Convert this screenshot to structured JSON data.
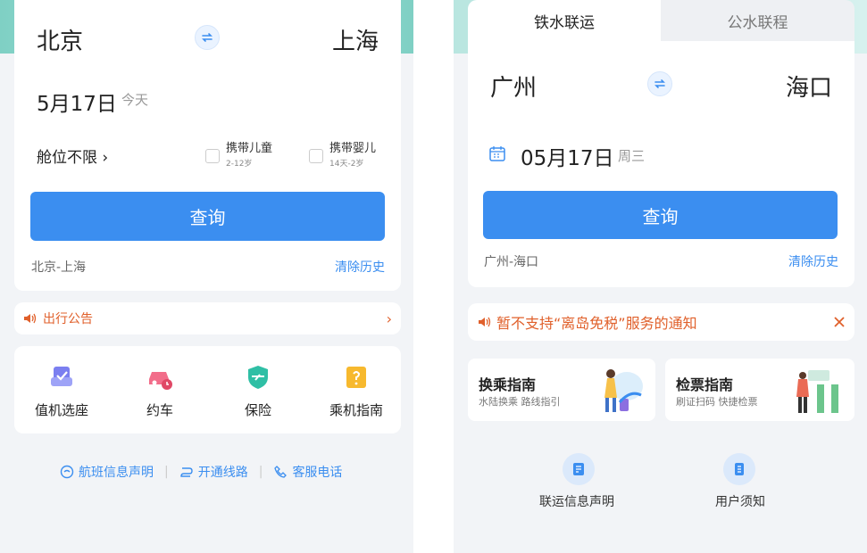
{
  "left": {
    "from_city": "北京",
    "to_city": "上海",
    "date": "5月17日",
    "date_tag": "今天",
    "cabin": "舱位不限 ›",
    "child": {
      "label": "携带儿童",
      "sub": "2-12岁"
    },
    "infant": {
      "label": "携带婴儿",
      "sub": "14天-2岁"
    },
    "search_label": "查询",
    "history": "北京-上海",
    "clear_history": "清除历史",
    "notice": "出行公告",
    "notice_arrow": "›",
    "services": [
      {
        "label": "值机选座",
        "icon": "seat-icon"
      },
      {
        "label": "约车",
        "icon": "car-icon"
      },
      {
        "label": "保险",
        "icon": "shield-icon"
      },
      {
        "label": "乘机指南",
        "icon": "guide-icon"
      }
    ],
    "footer": [
      {
        "label": "航班信息声明",
        "icon": "info-icon"
      },
      {
        "label": "开通线路",
        "icon": "route-icon"
      },
      {
        "label": "客服电话",
        "icon": "phone-icon"
      }
    ]
  },
  "right": {
    "tabs": [
      "铁水联运",
      "公水联程"
    ],
    "from_city": "广州",
    "to_city": "海口",
    "date": "05月17日",
    "weekday": "周三",
    "search_label": "查询",
    "history": "广州-海口",
    "clear_history": "清除历史",
    "notice": "暂不支持“离岛免税”服务的通知",
    "guides": [
      {
        "title": "换乘指南",
        "sub": "水陆换乘 路线指引"
      },
      {
        "title": "检票指南",
        "sub": "刷证扫码 快捷检票"
      }
    ],
    "links": [
      {
        "label": "联运信息声明",
        "icon": "document-icon"
      },
      {
        "label": "用户须知",
        "icon": "notice-icon"
      }
    ]
  },
  "colors": {
    "accent": "#3b8ef0",
    "notice": "#e0602b",
    "background": "#f2f4f7"
  }
}
